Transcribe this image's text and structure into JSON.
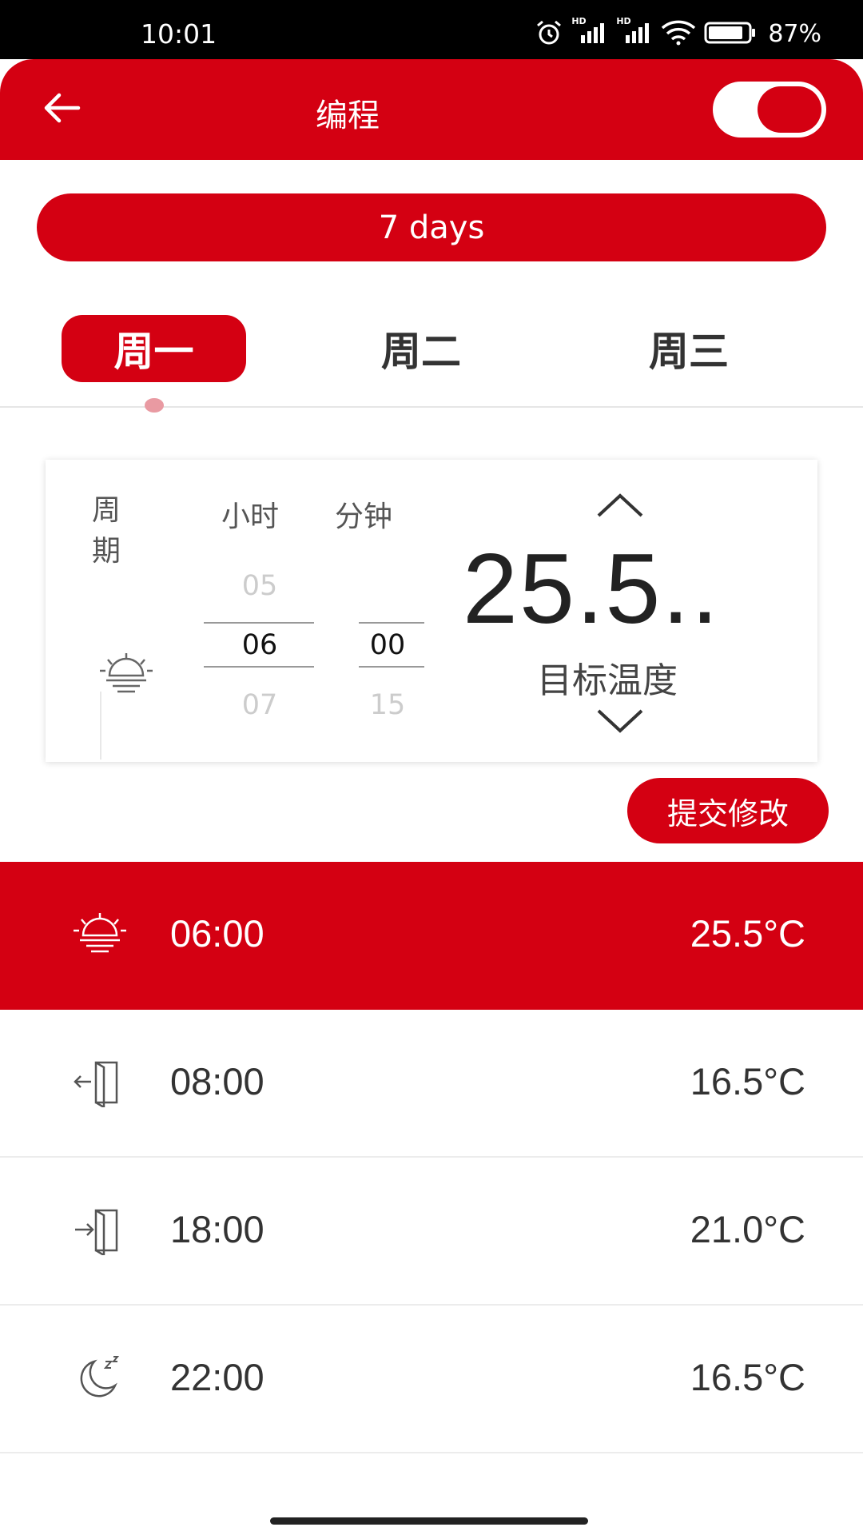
{
  "status_bar": {
    "time": "10:01",
    "battery": "87%",
    "network_1": "HD",
    "network_2": "HD"
  },
  "header": {
    "title": "编程",
    "toggle_on": true
  },
  "mode": {
    "label": "7 days"
  },
  "days": [
    {
      "label": "周一",
      "active": true
    },
    {
      "label": "周二",
      "active": false
    },
    {
      "label": "周三",
      "active": false
    }
  ],
  "editor": {
    "cycle_label": "周期",
    "hour_label": "小时",
    "minute_label": "分钟",
    "hours": [
      "05",
      "06",
      "07"
    ],
    "minutes": [
      "00",
      "15"
    ],
    "target_temp": "25.5..",
    "target_label": "目标温度"
  },
  "submit_label": "提交修改",
  "schedule": [
    {
      "icon": "sunrise-icon",
      "time": "06:00",
      "temp": "25.5°C",
      "active": true
    },
    {
      "icon": "leave-door-icon",
      "time": "08:00",
      "temp": "16.5°C",
      "active": false
    },
    {
      "icon": "return-door-icon",
      "time": "18:00",
      "temp": "21.0°C",
      "active": false
    },
    {
      "icon": "moon-sleep-icon",
      "time": "22:00",
      "temp": "16.5°C",
      "active": false
    }
  ],
  "colors": {
    "accent": "#d40012",
    "tab_indicator": "#e99aa2"
  }
}
